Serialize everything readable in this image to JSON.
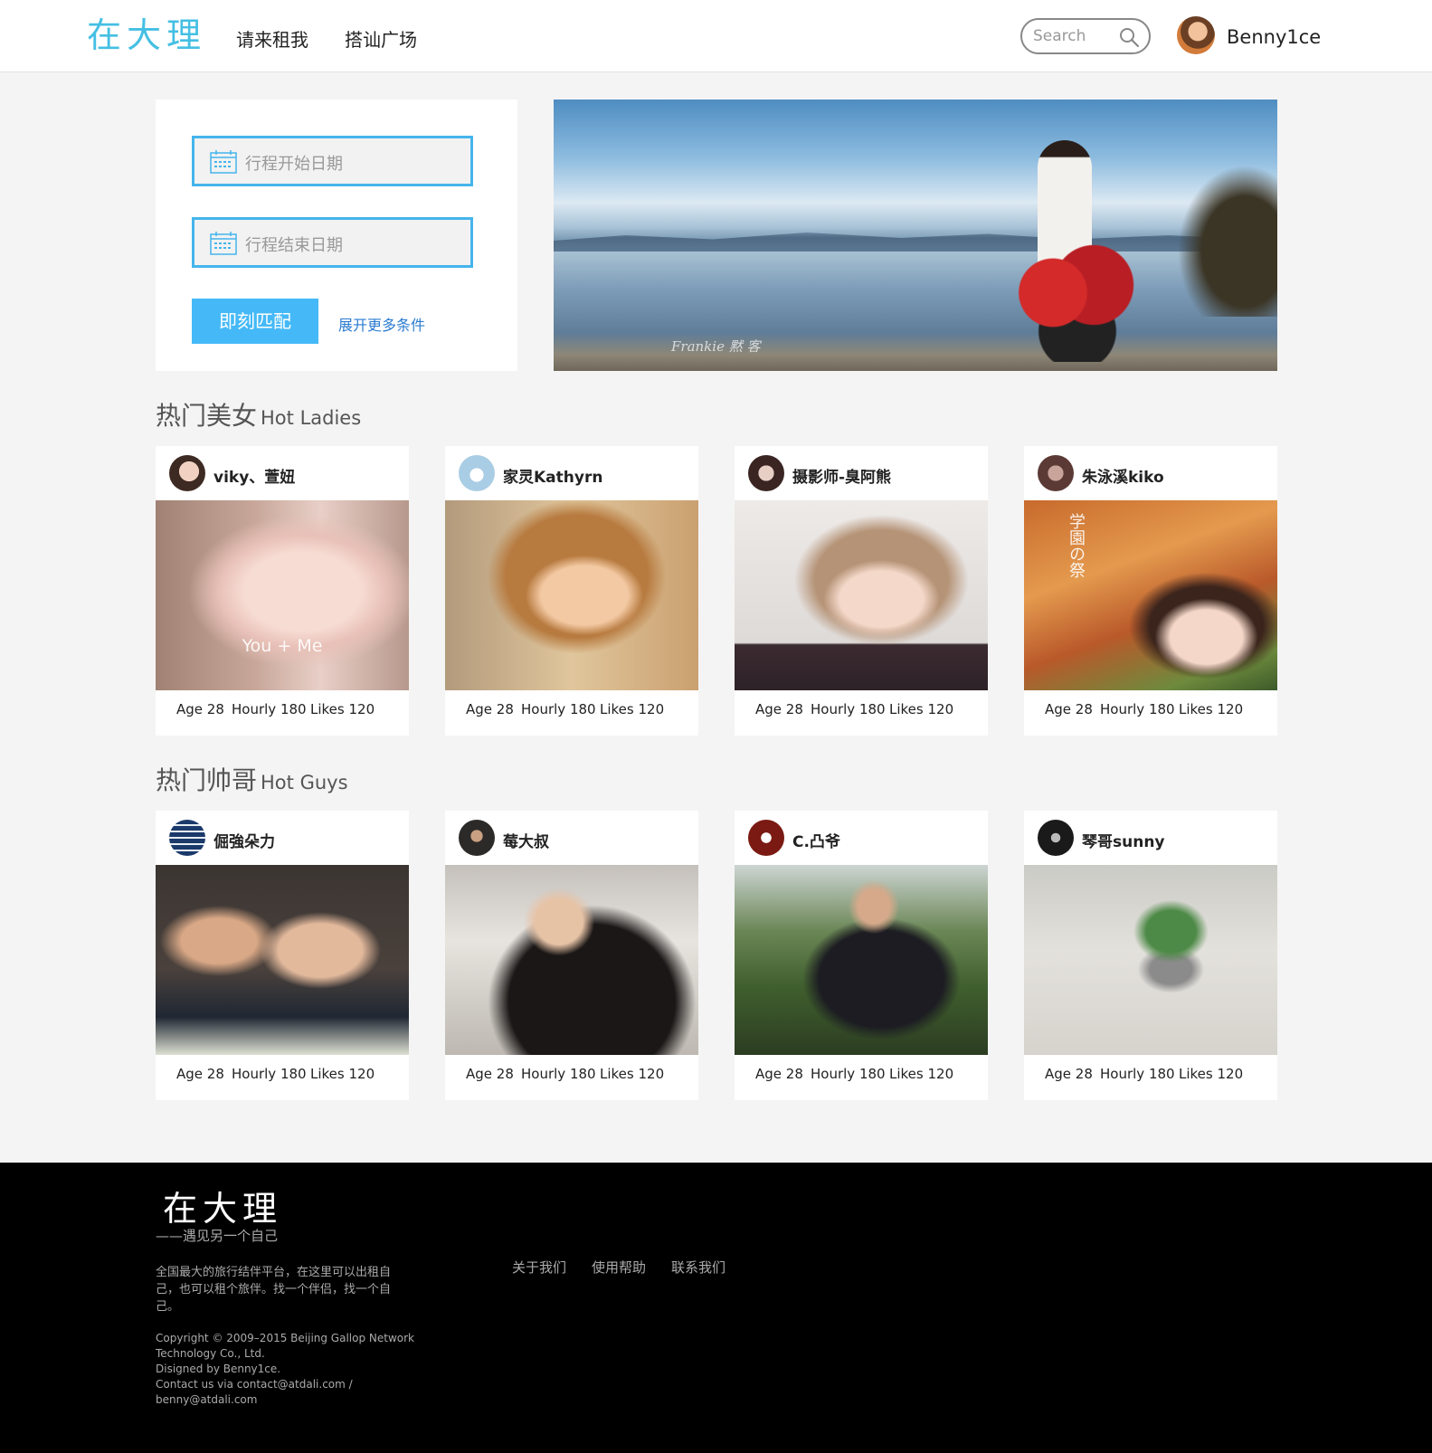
{
  "header": {
    "logo": "在大理",
    "nav": [
      "请来租我",
      "搭讪广场"
    ],
    "search_placeholder": "Search",
    "username": "Benny1ce"
  },
  "search_panel": {
    "start_date_placeholder": "行程开始日期",
    "end_date_placeholder": "行程结束日期",
    "match_button": "即刻匹配",
    "more_conditions": "展开更多条件"
  },
  "banner": {
    "watermark": "Frankie 黙 客"
  },
  "hot_ladies": {
    "title_cn": "热门美女",
    "title_en": "Hot Ladies",
    "cards": [
      {
        "name": "viky、萱妞",
        "age": "Age 28",
        "hourly": "Hourly 180",
        "likes": "Likes 120",
        "overlay": "You  +  Me"
      },
      {
        "name": "家灵Kathyrn",
        "age": "Age 28",
        "hourly": "Hourly 180",
        "likes": "Likes 120"
      },
      {
        "name": "摄影师-臭阿熊",
        "age": "Age 28",
        "hourly": "Hourly 180",
        "likes": "Likes 120"
      },
      {
        "name": "朱泳溪kiko",
        "age": "Age 28",
        "hourly": "Hourly 180",
        "likes": "Likes 120",
        "overlay": "学園の祭"
      }
    ]
  },
  "hot_guys": {
    "title_cn": "热门帅哥",
    "title_en": "Hot Guys",
    "cards": [
      {
        "name": "倔強朵力",
        "age": "Age 28",
        "hourly": "Hourly 180",
        "likes": "Likes 120"
      },
      {
        "name": "莓大叔",
        "age": "Age 28",
        "hourly": "Hourly 180",
        "likes": "Likes 120"
      },
      {
        "name": "C.凸爷",
        "age": "Age 28",
        "hourly": "Hourly 180",
        "likes": "Likes 120"
      },
      {
        "name": "琴哥sunny",
        "age": "Age 28",
        "hourly": "Hourly 180",
        "likes": "Likes 120"
      }
    ]
  },
  "footer": {
    "logo": "在大理",
    "slogan": "——遇见另一个自己",
    "description": "全国最大的旅行结伴平台，在这里可以出租自己，也可以租个旅伴。找一个伴侣，找一个自己。",
    "copyright": "Copyright © 2009–2015 Beijing Gallop Network Technology Co., Ltd.",
    "designer": "Disigned by Benny1ce.",
    "contact": "Contact us via contact@atdali.com / benny@atdali.com",
    "links": [
      "关于我们",
      "使用帮助",
      "联系我们"
    ]
  },
  "colors": {
    "accent": "#45b9f7",
    "logo": "#45bfe3",
    "link": "#2b7bd0",
    "footer_bg": "#000000",
    "page_bg": "#f4f4f4"
  }
}
